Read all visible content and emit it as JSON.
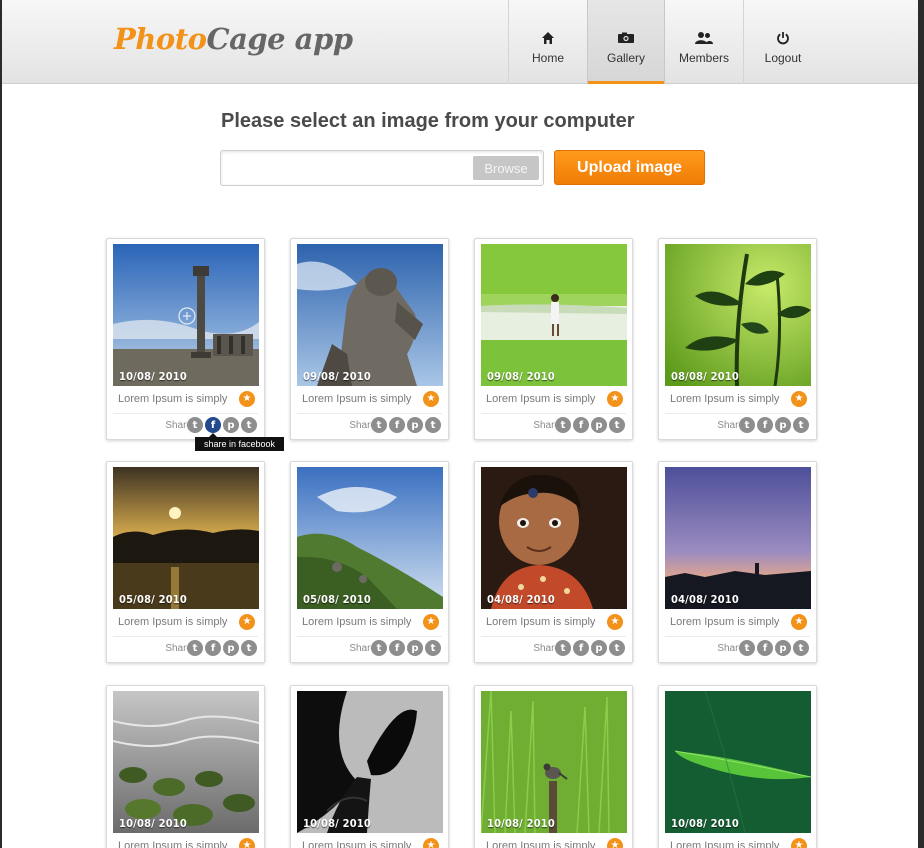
{
  "app": {
    "logo_part1": "Photo",
    "logo_part2": "Cage app"
  },
  "nav": [
    {
      "label": "Home",
      "icon": "home-icon"
    },
    {
      "label": "Gallery",
      "icon": "camera-icon",
      "active": true
    },
    {
      "label": "Members",
      "icon": "members-icon"
    },
    {
      "label": "Logout",
      "icon": "power-icon"
    }
  ],
  "upload": {
    "title": "Please select an image from your computer",
    "browse_label": "Browse",
    "button_label": "Upload image"
  },
  "gallery": {
    "share_label": "Share",
    "tooltip": "share in facebook",
    "items": [
      {
        "date": "10/08/ 2010",
        "caption": "Lorem Ipsum is simply",
        "scene": "pillar"
      },
      {
        "date": "09/08/ 2010",
        "caption": "Lorem Ipsum is simply",
        "scene": "statue"
      },
      {
        "date": "09/08/ 2010",
        "caption": "Lorem Ipsum is simply",
        "scene": "field-girl"
      },
      {
        "date": "08/08/ 2010",
        "caption": "Lorem Ipsum is simply",
        "scene": "plant"
      },
      {
        "date": "05/08/ 2010",
        "caption": "Lorem Ipsum is simply",
        "scene": "sunset-lake"
      },
      {
        "date": "05/08/ 2010",
        "caption": "Lorem Ipsum is simply",
        "scene": "hill"
      },
      {
        "date": "04/08/ 2010",
        "caption": "Lorem Ipsum is simply",
        "scene": "child"
      },
      {
        "date": "04/08/ 2010",
        "caption": "Lorem Ipsum is simply",
        "scene": "dusk-sky"
      },
      {
        "date": "10/08/ 2010",
        "caption": "Lorem Ipsum is simply",
        "scene": "rocks"
      },
      {
        "date": "10/08/ 2010",
        "caption": "Lorem Ipsum is simply",
        "scene": "butterfly"
      },
      {
        "date": "10/08/ 2010",
        "caption": "Lorem Ipsum is simply",
        "scene": "bird-grass"
      },
      {
        "date": "10/08/ 2010",
        "caption": "Lorem Ipsum is simply",
        "scene": "leaf"
      }
    ]
  },
  "colors": {
    "accent": "#f39219",
    "logo_gray": "#666666",
    "facebook": "#234a8f"
  }
}
